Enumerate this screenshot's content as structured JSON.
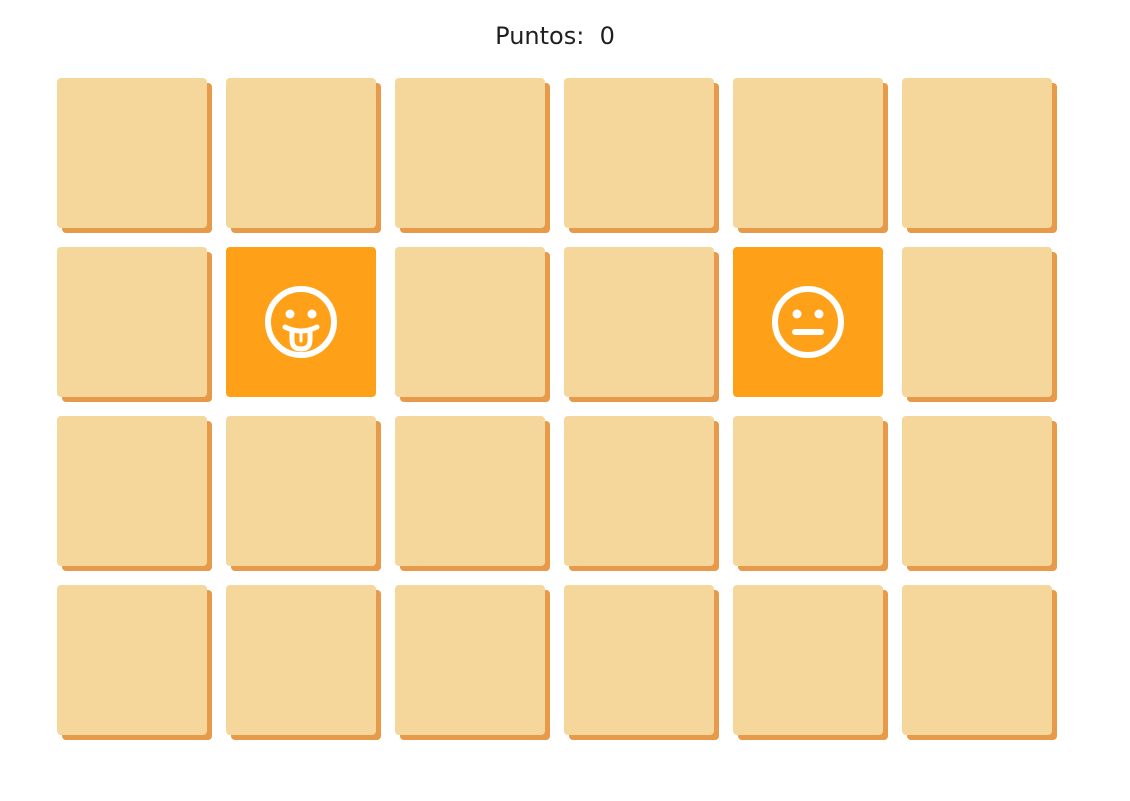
{
  "score": {
    "label": "Puntos:",
    "value": "0"
  },
  "board": {
    "rows": 4,
    "columns": 6,
    "face_down_color": "#f6d79b",
    "face_down_shadow_color": "#e69a4a",
    "face_up_color": "#fea118",
    "revealed": [
      {
        "row": 2,
        "column": 2,
        "icon": "tongue-out-face-icon"
      },
      {
        "row": 2,
        "column": 5,
        "icon": "neutral-face-icon"
      }
    ]
  }
}
